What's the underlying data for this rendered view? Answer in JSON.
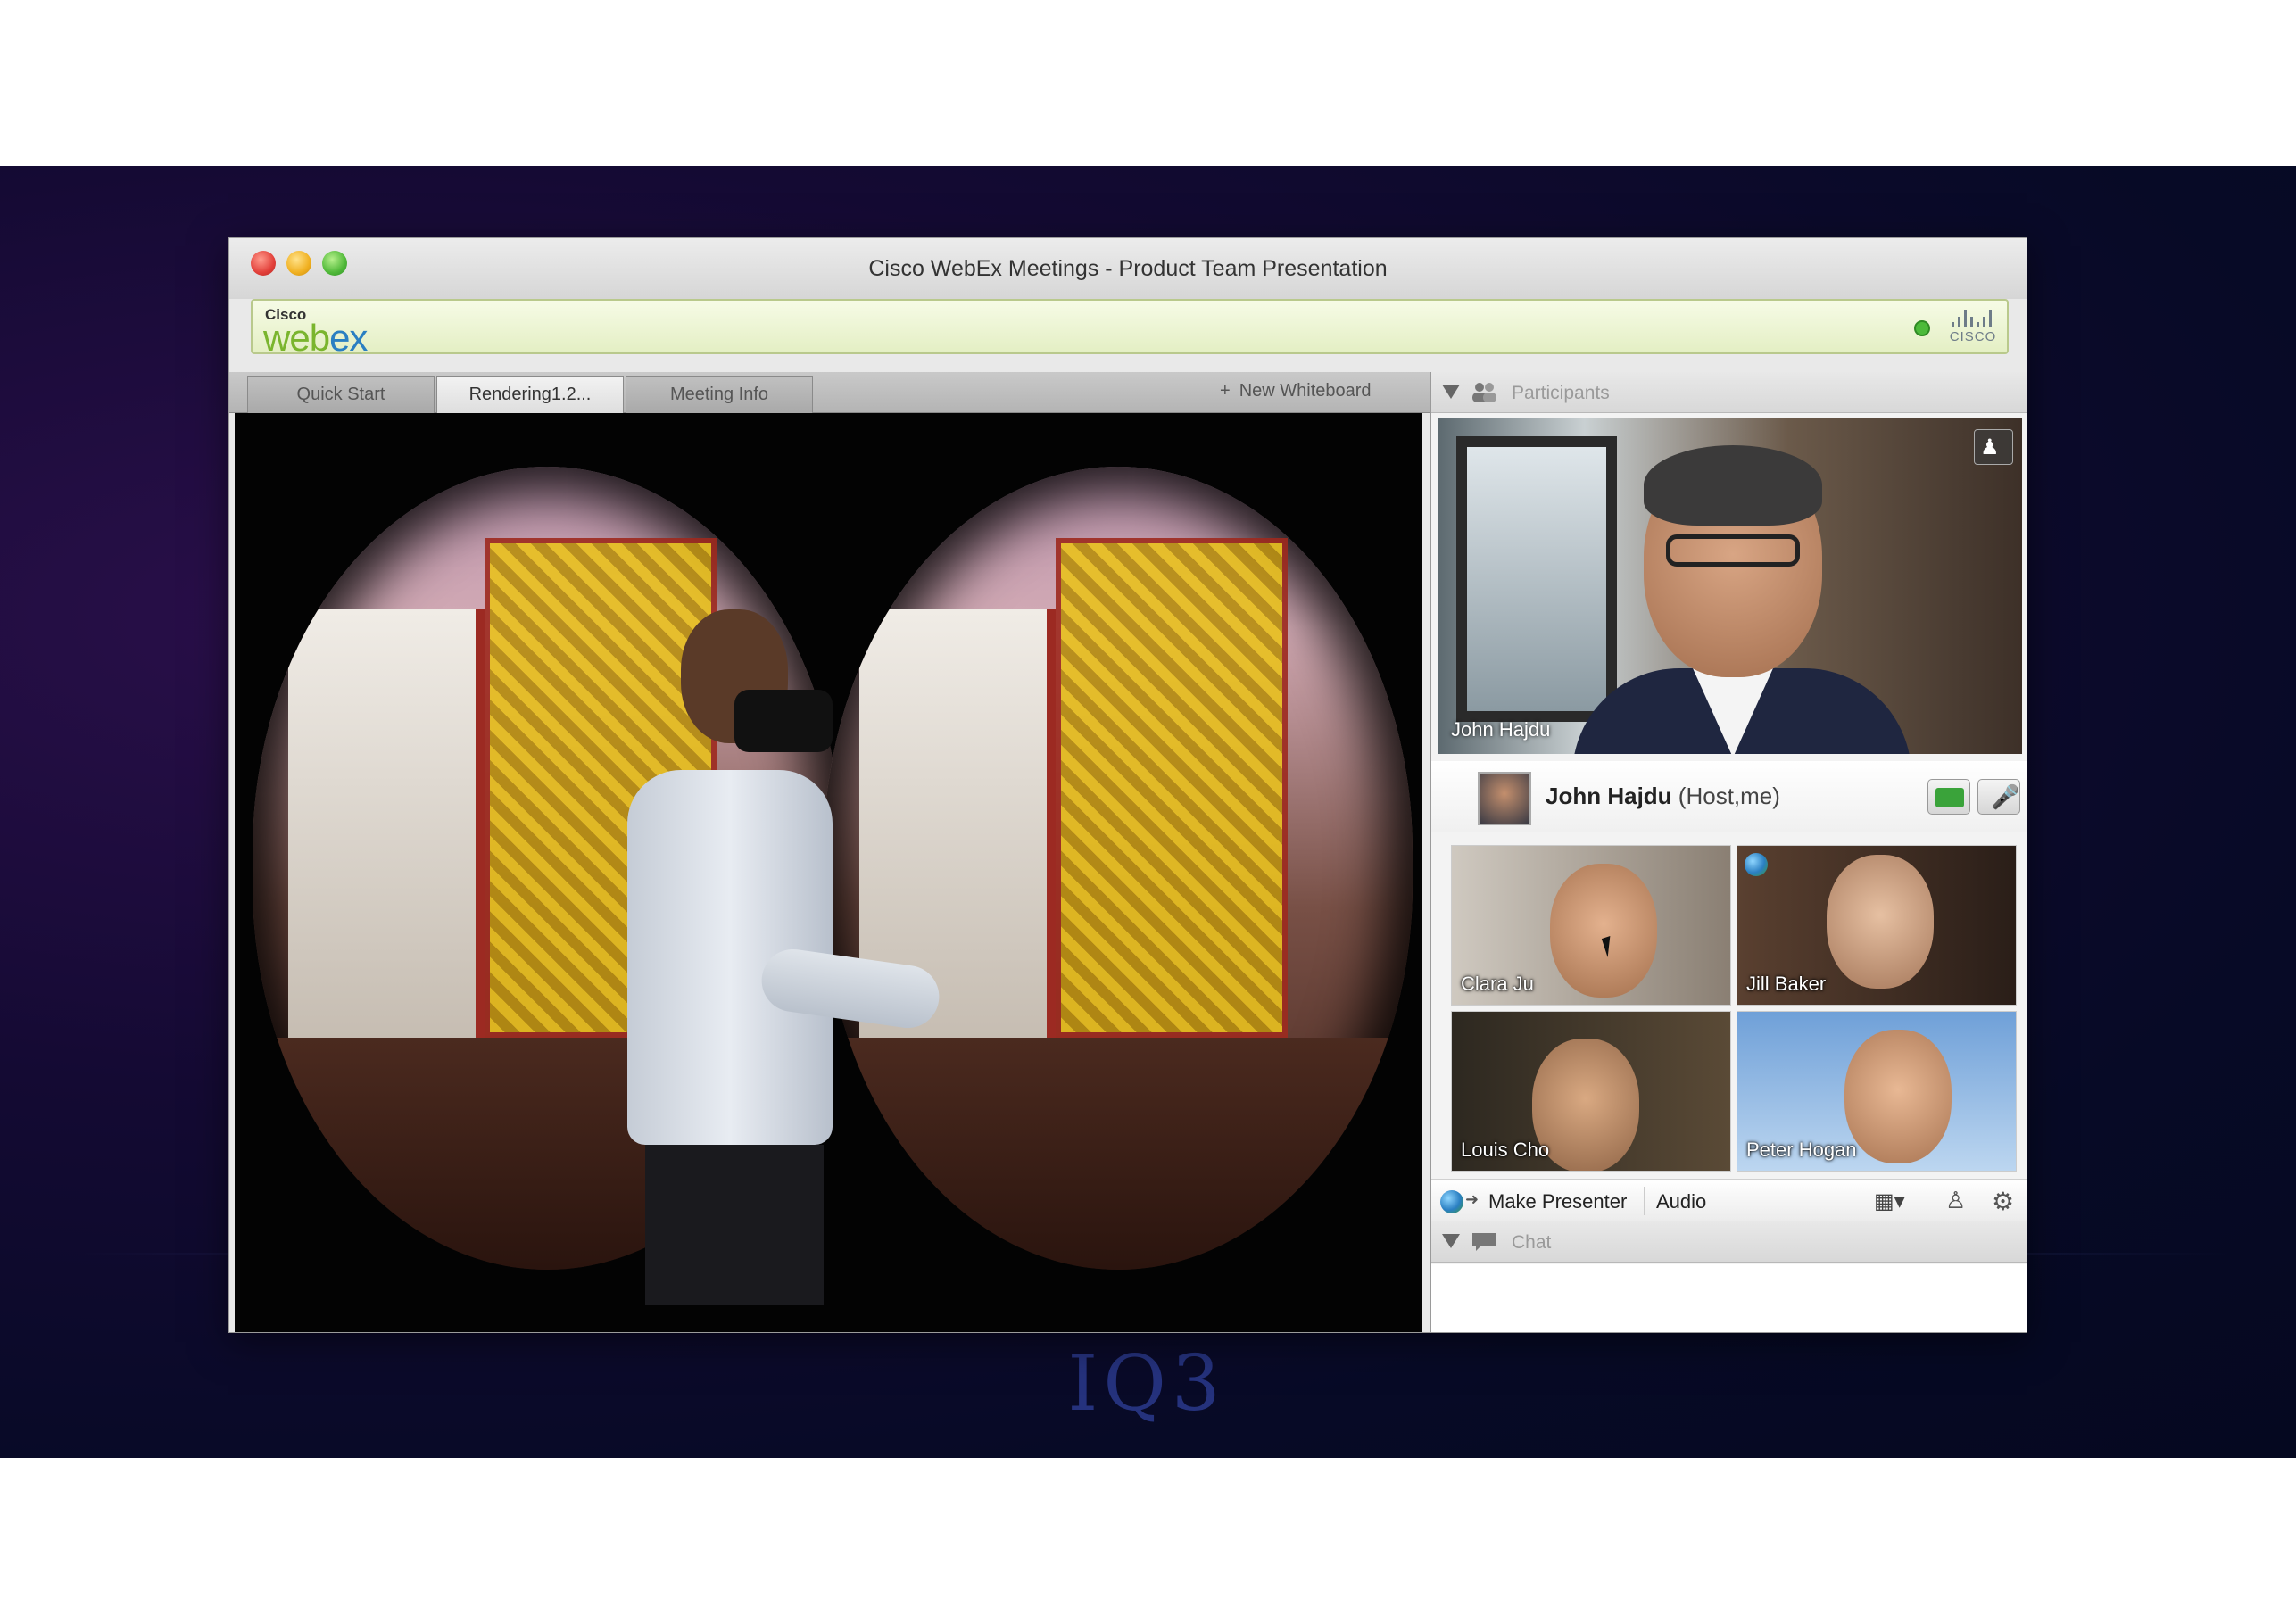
{
  "window": {
    "title": "Cisco WebEx Meetings - Product Team Presentation"
  },
  "brand_bar": {
    "logo_small": "Cisco",
    "logo_main_a": "web",
    "logo_main_b": "ex",
    "cisco_label": "CISCO"
  },
  "tabs": [
    {
      "label": "Quick Start",
      "active": false
    },
    {
      "label": "Rendering1.2...",
      "active": true
    },
    {
      "label": "Meeting Info",
      "active": false
    }
  ],
  "new_whiteboard": {
    "plus": "+",
    "label": "New Whiteboard"
  },
  "participants": {
    "header_label": "Participants",
    "active_video": {
      "name": "John Hajdu"
    },
    "host": {
      "name": "John Hajdu",
      "role": "(Host,me)"
    },
    "thumbnails": [
      {
        "name": "Clara Ju"
      },
      {
        "name": "Jill Baker"
      },
      {
        "name": "Louis Cho"
      },
      {
        "name": "Peter Hogan"
      }
    ]
  },
  "actions": {
    "make_presenter": "Make Presenter",
    "audio": "Audio"
  },
  "chat": {
    "header_label": "Chat"
  },
  "watermark": {
    "text": "IQ3"
  },
  "colors": {
    "webex_green": "#7ab52e",
    "webex_blue": "#2a7fc2",
    "status_green": "#4cba3a",
    "video_green": "#3aa33a"
  }
}
